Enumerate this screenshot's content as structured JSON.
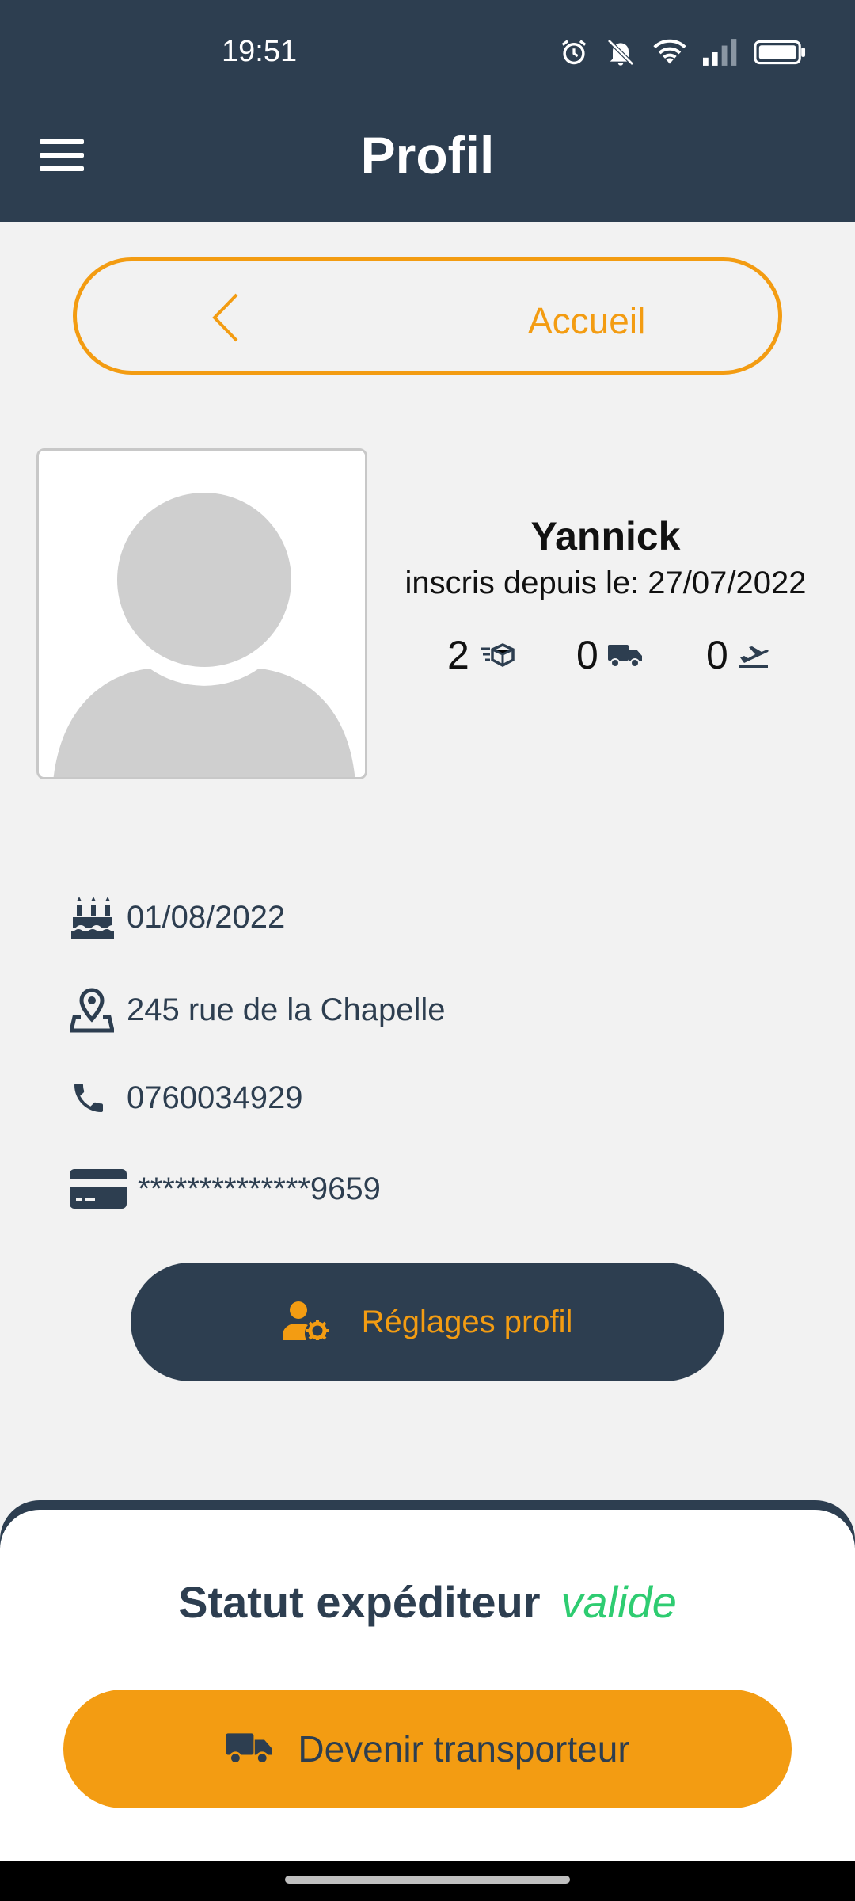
{
  "status_bar": {
    "time": "19:51"
  },
  "header": {
    "title": "Profil"
  },
  "back_button": {
    "label": "Accueil"
  },
  "profile": {
    "name": "Yannick",
    "member_since": "inscris depuis le: 27/07/2022",
    "stats": [
      {
        "value": "2",
        "icon": "package-delivery-icon"
      },
      {
        "value": "0",
        "icon": "truck-icon"
      },
      {
        "value": "0",
        "icon": "plane-departure-icon"
      }
    ]
  },
  "info": {
    "birthday": "01/08/2022",
    "address": "245 rue de la Chapelle",
    "phone": "0760034929",
    "card": "**************9659"
  },
  "settings_button": {
    "label": "Réglages profil"
  },
  "sheet": {
    "status_label": "Statut expéditeur",
    "status_value": "valide",
    "cta_label": "Devenir transporteur"
  },
  "colors": {
    "primary": "#2d3e50",
    "accent": "#f39c12",
    "success": "#2ecc71",
    "background": "#f2f2f2"
  }
}
